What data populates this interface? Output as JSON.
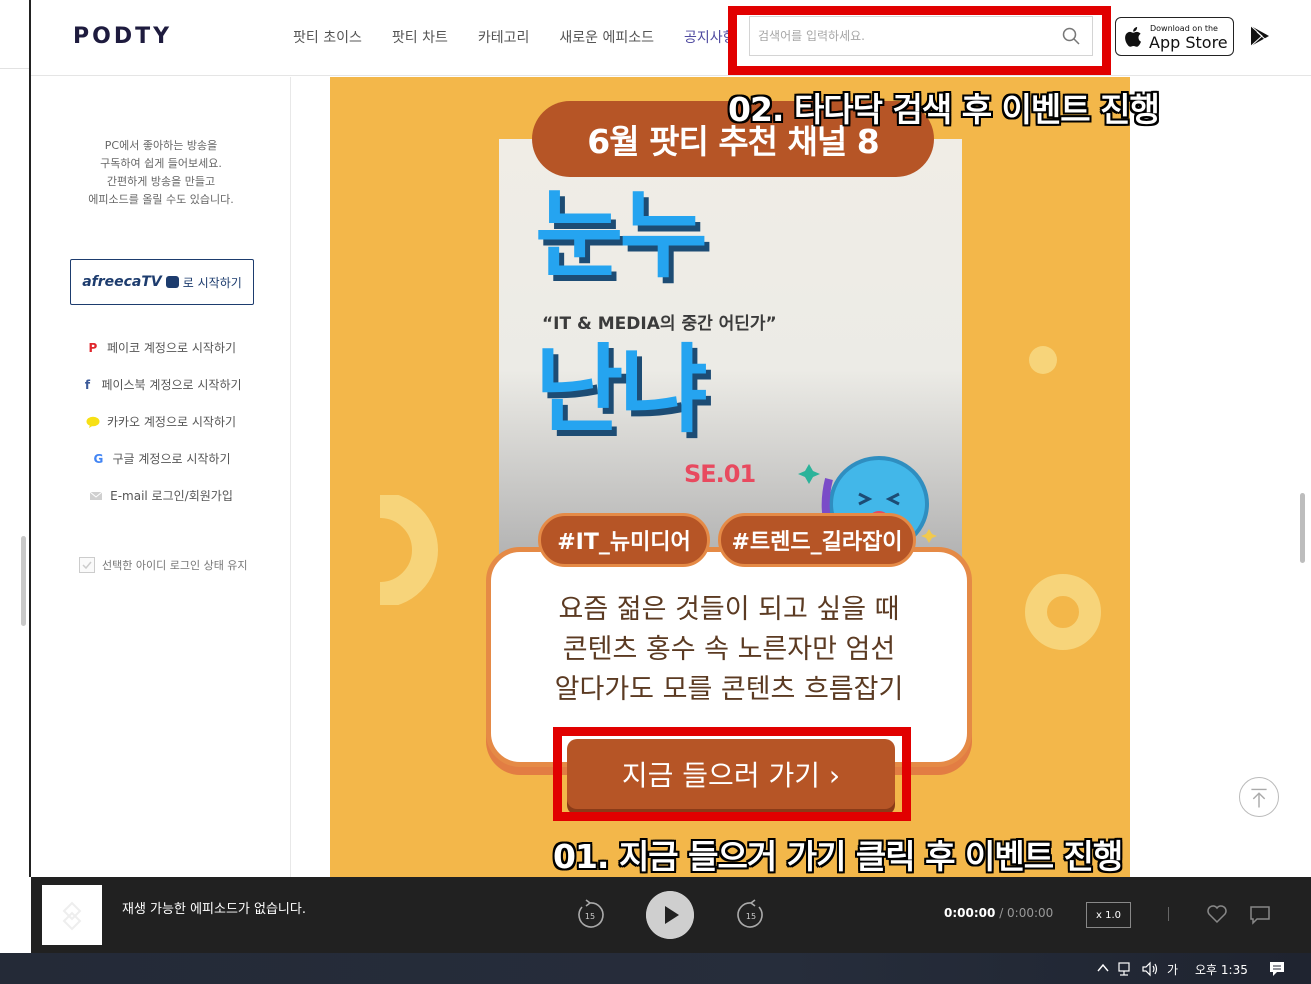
{
  "header": {
    "logo": "PODTY",
    "nav": [
      "팟티 초이스",
      "팟티 차트",
      "카테고리",
      "새로운 에피소드",
      "공지사항"
    ],
    "search_placeholder": "검색어를 입력하세요.",
    "appstore_small": "Download on the",
    "appstore_big": "App Store"
  },
  "sidebar": {
    "intro": [
      "PC에서 좋아하는 방송을",
      "구독하여 쉽게 들어보세요.",
      "간편하게 방송을 만들고",
      "에피소드를 올릴 수도 있습니다."
    ],
    "afreeca_logo": "afreecaTV",
    "afreeca_text": "로 시작하기",
    "logins": [
      {
        "icon": "P",
        "label": "페이코 계정으로 시작하기",
        "color": "#e0262c"
      },
      {
        "icon": "f",
        "label": "페이스북 계정으로 시작하기",
        "color": "#3b5998"
      },
      {
        "icon": "kakao",
        "label": "카카오 계정으로 시작하기",
        "color": "#f7e015"
      },
      {
        "icon": "G",
        "label": "구글 계정으로 시작하기",
        "color": "#4285f4"
      },
      {
        "icon": "mail",
        "label": "E-mail 로그인/회원가입",
        "color": "#bbbbbb"
      }
    ],
    "keep_login": "선택한 아이디 로그인 상태 유지"
  },
  "banner": {
    "title": "6월 팟티 추천 채널 8",
    "word1": "눈누",
    "tagline": "“IT & MEDIA의 중간 어딘가”",
    "word2": "난냐",
    "season": "SE.01",
    "tags": [
      "#IT_뉴미디어",
      "#트렌드_길라잡이"
    ],
    "description": [
      "요즘 젊은 것들이 되고 싶을 때",
      "콘텐츠 홍수 속 노른자만 엄선",
      "알다가도 모를 콘텐츠 흐름잡기"
    ],
    "cta": "지금 들으러 가기 ›"
  },
  "annotations": {
    "step2": "02. 타다닥 검색 후 이벤트 진행",
    "step1": "01. 지금 들으거 가기 클릭 후 이벤트 진행"
  },
  "player": {
    "status": "재생 가능한 에피소드가 없습니다.",
    "rewind": "15",
    "forward": "15",
    "current_time": "0:00:00",
    "duration": "/ 0:00:00",
    "speed": "x 1.0"
  },
  "taskbar": {
    "ime": "가",
    "clock": "오후 1:35"
  },
  "colors": {
    "brand": "#1e1b3e",
    "banner_bg": "#f3b74a",
    "banner_accent": "#b65526",
    "annotation": "#e10000"
  }
}
